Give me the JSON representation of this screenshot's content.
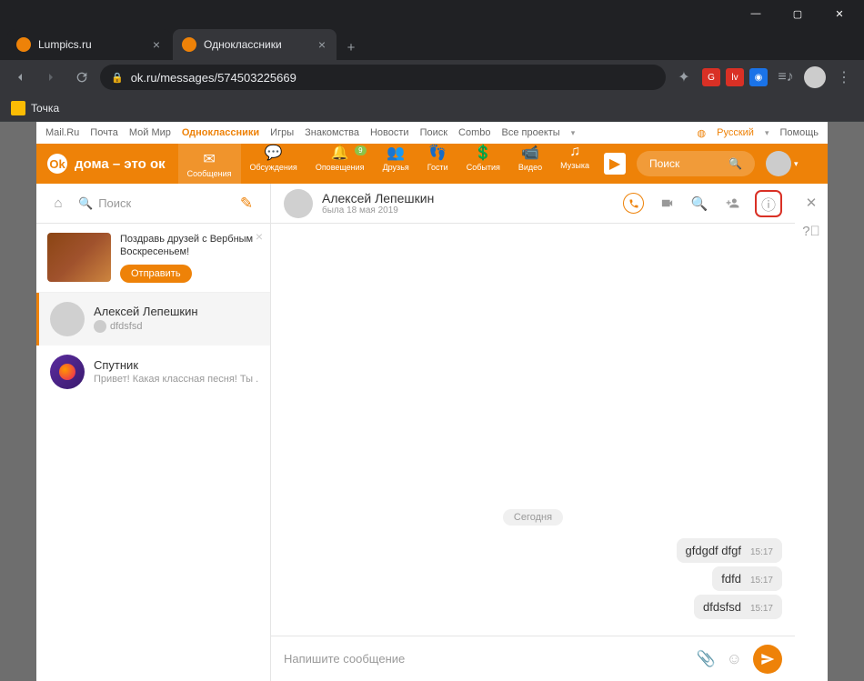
{
  "window": {
    "tabs": [
      {
        "title": "Lumpics.ru",
        "favicon": "#ee8208"
      },
      {
        "title": "Одноклассники",
        "favicon": "#ee8208"
      }
    ],
    "active_tab": 1
  },
  "browser": {
    "url": "ok.ru/messages/574503225669",
    "bookmark": "Toчка"
  },
  "topbar": {
    "links": [
      "Mail.Ru",
      "Почта",
      "Мой Мир",
      "Одноклассники",
      "Игры",
      "Знакомства",
      "Новости",
      "Поиск",
      "Combo",
      "Все проекты"
    ],
    "active": 3,
    "lang": "Русский",
    "help": "Помощь"
  },
  "navbar": {
    "logo": "дома – это ок",
    "items": [
      {
        "l": "Сообщения",
        "ic": "✉"
      },
      {
        "l": "Обсуждения",
        "ic": "💬"
      },
      {
        "l": "Оповещения",
        "ic": "🔔",
        "badge": "9"
      },
      {
        "l": "Друзья",
        "ic": "👥"
      },
      {
        "l": "Гости",
        "ic": "👣"
      },
      {
        "l": "События",
        "ic": "💲"
      },
      {
        "l": "Видео",
        "ic": "📹"
      },
      {
        "l": "Музыка",
        "ic": "♫"
      }
    ],
    "search": "Поиск"
  },
  "sidebar": {
    "search": "Поиск",
    "promo": {
      "text": "Поздравь друзей с Вербным Воскресеньем!",
      "btn": "Отправить"
    },
    "conversations": [
      {
        "name": "Алексей Лепешкин",
        "last": "dfdsfsd",
        "own": true,
        "active": true
      },
      {
        "name": "Спутник",
        "last": "Привет! Какая классная песня! Ты ..."
      }
    ]
  },
  "chat": {
    "name": "Алексей Лепешкин",
    "status": "была 18 мая 2019",
    "date": "Сегодня",
    "messages": [
      {
        "text": "gfdgdf dfgf",
        "time": "15:17"
      },
      {
        "text": "fdfd",
        "time": "15:17"
      },
      {
        "text": "dfdsfsd",
        "time": "15:17"
      }
    ],
    "placeholder": "Напишите сообщение"
  }
}
